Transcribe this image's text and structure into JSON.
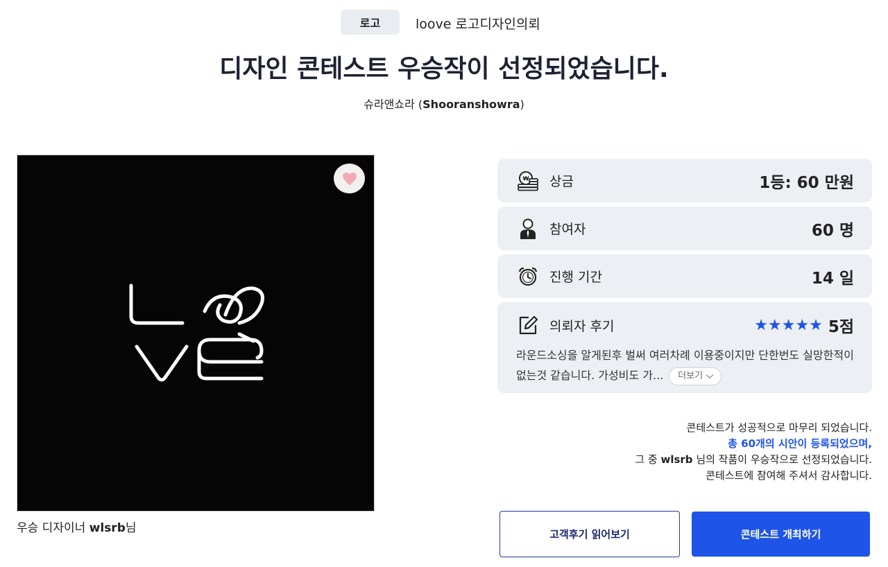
{
  "header": {
    "category_tag": "로고",
    "contest_name": "loove 로고디자인의뢰",
    "headline": "디자인 콘테스트 우승작이 선정되었습니다.",
    "client_name": "슈라앤쇼라 (",
    "client_name_en": "Shooranshowra",
    "client_name_close": ")"
  },
  "winning_work": {
    "caption_prefix": "우승 디자이너 ",
    "designer": "wlsrb",
    "caption_suffix": "님",
    "heart_icon": "heart-icon"
  },
  "info": {
    "prize": {
      "label": "상금",
      "value": "1등: 60 만원",
      "icon": "prize-money-icon"
    },
    "participants": {
      "label": "참여자",
      "value": "60 명",
      "icon": "person-icon"
    },
    "duration": {
      "label": "진행 기간",
      "value": "14 일",
      "icon": "alarm-clock-icon"
    },
    "review": {
      "label": "의뢰자 후기",
      "stars": "★★★★★",
      "rating_value": 5,
      "score": "5점",
      "text": "라운드소싱을 알게된후 벌써 여러차례 이용중이지만 단한번도 실망한적이 없는것 같습니다. 가성비도 가...",
      "more_label": "더보기",
      "icon": "edit-note-icon"
    }
  },
  "summary": {
    "line1": "콘테스트가 성공적으로 마무리 되었습니다.",
    "line2": "총 60개의 시안이 등록되었으며,",
    "line3_prefix": "그 중 ",
    "line3_name": "wlsrb",
    "line3_suffix": " 님의 작품이 우승작으로 선정되었습니다.",
    "line4": "콘테스트에 참여해 주셔서 감사합니다."
  },
  "buttons": {
    "read_reviews": "고객후기 읽어보기",
    "host_contest": "콘테스트 개최하기"
  },
  "colors": {
    "accent": "#1e54e8",
    "card_bg": "#eceff3",
    "artwork_bg": "#050505",
    "heart": "#f2a9b5"
  }
}
